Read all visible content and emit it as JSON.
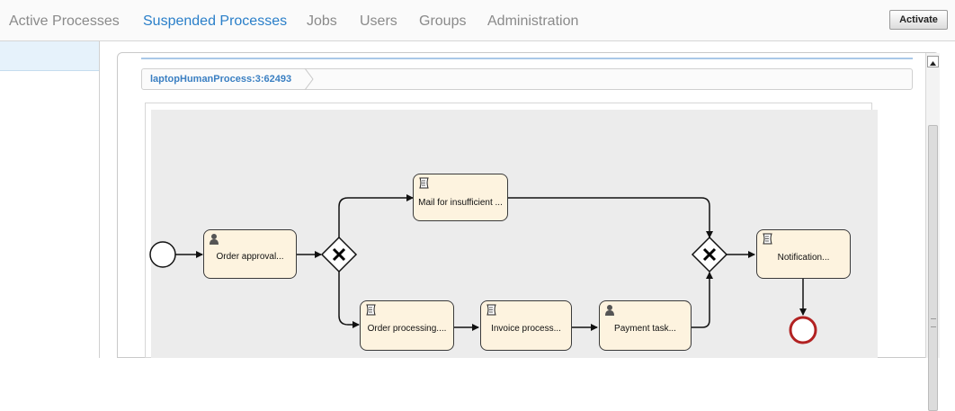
{
  "nav": {
    "items": [
      {
        "label": "Active Processes"
      },
      {
        "label": "Suspended Processes"
      },
      {
        "label": "Jobs"
      },
      {
        "label": "Users"
      },
      {
        "label": "Groups"
      },
      {
        "label": "Administration"
      }
    ],
    "active": "Suspended Processes"
  },
  "toolbar": {
    "activate_label": "Activate"
  },
  "breadcrumb": {
    "label": "laptopHumanProcess:3:62493"
  },
  "diagram": {
    "tasks": [
      {
        "label": "Order approval...",
        "icon": "user-task-icon"
      },
      {
        "label": "Mail for insufficient ...",
        "icon": "script-task-icon"
      },
      {
        "label": "Order processing....",
        "icon": "script-task-icon"
      },
      {
        "label": "Invoice process...",
        "icon": "script-task-icon"
      },
      {
        "label": "Payment task...",
        "icon": "user-task-icon"
      },
      {
        "label": "Notification...",
        "icon": "script-task-icon"
      }
    ],
    "gateways": [
      "exclusive-gateway-split",
      "exclusive-gateway-join"
    ],
    "events": [
      "start-event",
      "end-event"
    ]
  },
  "colors": {
    "active_tab": "#2a7fc9",
    "inactive_tab": "#8a8a8a",
    "task_fill": "#fdf3df",
    "end_event": "#b22222",
    "canvas": "#ececec"
  }
}
